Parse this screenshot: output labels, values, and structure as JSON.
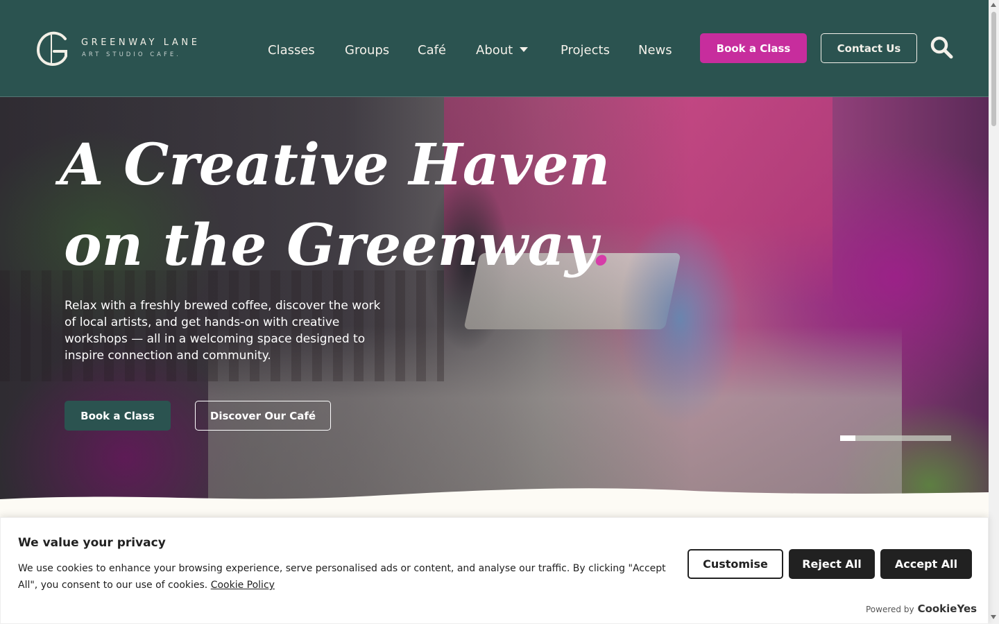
{
  "brand": {
    "line1": "GREENWAY LANE",
    "line2": "ART STUDIO CAFE."
  },
  "nav": {
    "items": [
      {
        "label": "Classes"
      },
      {
        "label": "Groups"
      },
      {
        "label": "Café"
      },
      {
        "label": "About"
      },
      {
        "label": "Projects"
      },
      {
        "label": "News"
      }
    ],
    "book_label": "Book a Class",
    "contact_label": "Contact Us"
  },
  "hero": {
    "title_line1": "A Creative Haven",
    "title_line2": "on the Greenway",
    "title_dot": ".",
    "text": "Relax with a freshly brewed coffee, discover the work of local artists, and get hands-on with creative workshops — all in a welcoming space designed to inspire connection and community.",
    "book_label": "Book a Class",
    "cafe_label": "Discover Our Café",
    "slider_progress": 0.14
  },
  "cookie": {
    "title": "We value your privacy",
    "text": "We use cookies to enhance your browsing experience, serve personalised ads or content, and analyse our traffic. By clicking \"Accept All\", you consent to our use of cookies.",
    "link": "Cookie Policy",
    "customise_label": "Customise",
    "reject_label": "Reject All",
    "accept_label": "Accept All",
    "powered_by": "Powered by",
    "powered_brand": "CookieYes"
  },
  "colors": {
    "header_bg": "#2b5350",
    "accent_magenta": "#c72d9d",
    "dark_button": "#212121"
  }
}
